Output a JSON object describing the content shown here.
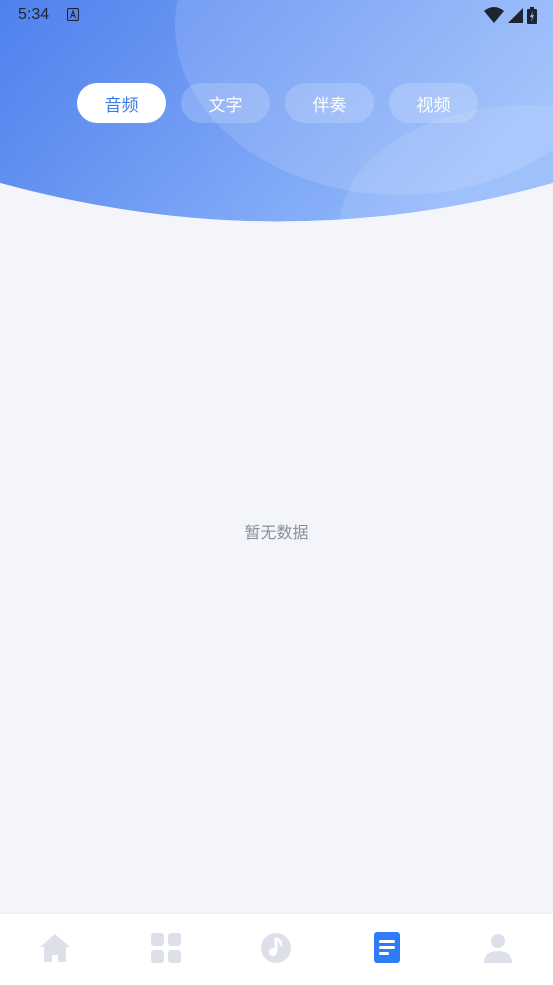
{
  "status_bar": {
    "time": "5:34"
  },
  "tabs": [
    {
      "label": "音频",
      "active": true
    },
    {
      "label": "文字",
      "active": false
    },
    {
      "label": "伴奏",
      "active": false
    },
    {
      "label": "视频",
      "active": false
    }
  ],
  "empty_state": {
    "text": "暂无数据"
  },
  "bottom_nav": {
    "items": [
      {
        "icon": "home-icon",
        "active": false
      },
      {
        "icon": "grid-icon",
        "active": false
      },
      {
        "icon": "music-note-icon",
        "active": false
      },
      {
        "icon": "document-list-icon",
        "active": true
      },
      {
        "icon": "user-icon",
        "active": false
      }
    ]
  },
  "colors": {
    "header_start": "#5283ee",
    "header_end": "#93b9fb",
    "active_tab_text": "#3d7bea",
    "nav_active": "#2f7cf6",
    "nav_inactive": "#dde0e8",
    "background": "#f4f5fa"
  }
}
